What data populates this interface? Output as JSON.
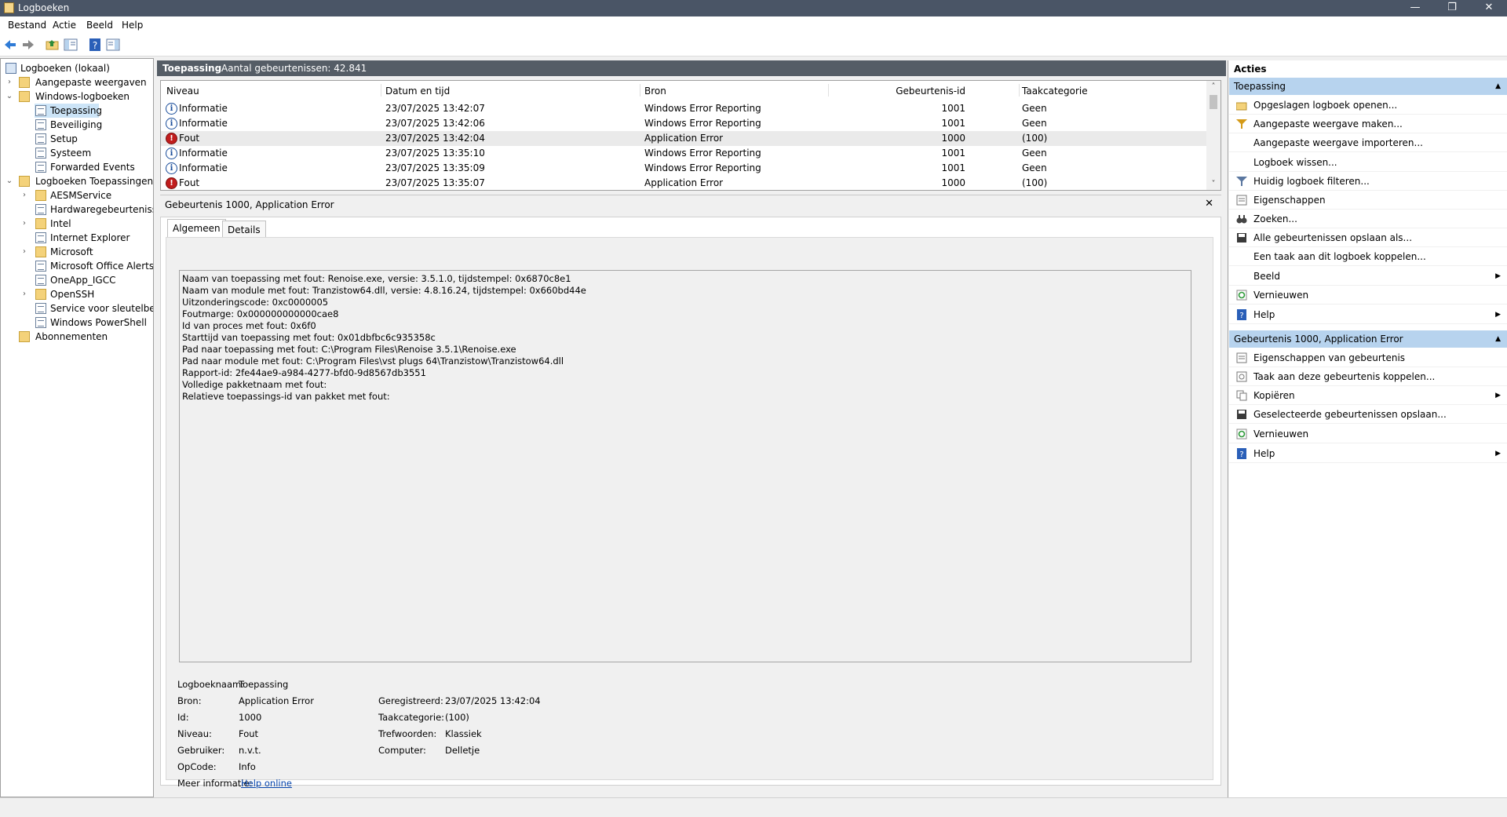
{
  "window": {
    "title": "Logboeken",
    "minimize": "—",
    "maximize": "❐",
    "close": "✕"
  },
  "menu": [
    {
      "label": "Bestand"
    },
    {
      "label": "Actie"
    },
    {
      "label": "Beeld"
    },
    {
      "label": "Help"
    }
  ],
  "tree": {
    "root": "Logboeken (lokaal)",
    "custom_views": "Aangepaste weergaven",
    "windows_logs": "Windows-logboeken",
    "windows_children": [
      "Toepassing",
      "Beveiliging",
      "Setup",
      "Systeem",
      "Forwarded Events"
    ],
    "app_logs": "Logboeken Toepassingen en",
    "app_children": [
      "AESMService",
      "Hardwaregebeurtenissen",
      "Intel",
      "Internet Explorer",
      "Microsoft",
      "Microsoft Office Alerts",
      "OneApp_IGCC",
      "OpenSSH",
      "Service voor sleutelbehee",
      "Windows PowerShell"
    ],
    "subscriptions": "Abonnementen"
  },
  "center": {
    "log_name": "Toepassing",
    "count_text": "Aantal gebeurtenissen: 42.841"
  },
  "columns": [
    "Niveau",
    "Datum en tijd",
    "Bron",
    "Gebeurtenis-id",
    "Taakcategorie"
  ],
  "events": [
    {
      "level": "Informatie",
      "type": "info",
      "datetime": "23/07/2025 13:42:07",
      "source": "Windows Error Reporting",
      "id": "1001",
      "category": "Geen"
    },
    {
      "level": "Informatie",
      "type": "info",
      "datetime": "23/07/2025 13:42:06",
      "source": "Windows Error Reporting",
      "id": "1001",
      "category": "Geen"
    },
    {
      "level": "Fout",
      "type": "error",
      "datetime": "23/07/2025 13:42:04",
      "source": "Application Error",
      "id": "1000",
      "category": "(100)"
    },
    {
      "level": "Informatie",
      "type": "info",
      "datetime": "23/07/2025 13:35:10",
      "source": "Windows Error Reporting",
      "id": "1001",
      "category": "Geen"
    },
    {
      "level": "Informatie",
      "type": "info",
      "datetime": "23/07/2025 13:35:09",
      "source": "Windows Error Reporting",
      "id": "1001",
      "category": "Geen"
    },
    {
      "level": "Fout",
      "type": "error",
      "datetime": "23/07/2025 13:35:07",
      "source": "Application Error",
      "id": "1000",
      "category": "(100)"
    }
  ],
  "detail": {
    "header": "Gebeurtenis 1000, Application Error",
    "tabs": [
      "Algemeen",
      "Details"
    ],
    "description": [
      "Naam van toepassing met fout: Renoise.exe, versie: 3.5.1.0, tijdstempel: 0x6870c8e1",
      "Naam van module met fout: Tranzistow64.dll, versie: 4.8.16.24, tijdstempel: 0x660bd44e",
      "Uitzonderingscode: 0xc0000005",
      "Foutmarge: 0x000000000000cae8",
      "Id van proces met fout: 0x6f0",
      "Starttijd van toepassing met fout: 0x01dbfbc6c935358c",
      "Pad naar toepassing met fout: C:\\Program Files\\Renoise 3.5.1\\Renoise.exe",
      "Pad naar module met fout: C:\\Program Files\\vst plugs 64\\Tranzistow\\Tranzistow64.dll",
      "Rapport-id: 2fe44ae9-a984-4277-bfd0-9d8567db3551",
      "Volledige pakketnaam met fout:",
      "Relatieve toepassings-id van pakket met fout:"
    ],
    "fields_left": [
      {
        "label": "Logboeknaam:",
        "value": "Toepassing"
      },
      {
        "label": "Bron:",
        "value": "Application Error"
      },
      {
        "label": "Id:",
        "value": "1000"
      },
      {
        "label": "Niveau:",
        "value": "Fout"
      },
      {
        "label": "Gebruiker:",
        "value": "n.v.t."
      },
      {
        "label": "OpCode:",
        "value": "Info"
      },
      {
        "label": "Meer informatie:",
        "value": "Help online"
      }
    ],
    "fields_right": [
      {
        "label": "Geregistreerd:",
        "value": "23/07/2025 13:42:04"
      },
      {
        "label": "Taakcategorie:",
        "value": "(100)"
      },
      {
        "label": "Trefwoorden:",
        "value": "Klassiek"
      },
      {
        "label": "Computer:",
        "value": "Delletje"
      }
    ]
  },
  "actions": {
    "title": "Acties",
    "section1": "Toepassing",
    "items1": [
      {
        "label": "Opgeslagen logboek openen...",
        "icon": "folder-open-icon"
      },
      {
        "label": "Aangepaste weergave maken...",
        "icon": "filter-icon"
      },
      {
        "label": "Aangepaste weergave importeren...",
        "icon": ""
      },
      {
        "label": "Logboek wissen...",
        "icon": ""
      },
      {
        "label": "Huidig logboek filteren...",
        "icon": "filter-icon"
      },
      {
        "label": "Eigenschappen",
        "icon": "properties-icon"
      },
      {
        "label": "Zoeken...",
        "icon": "binoculars-icon"
      },
      {
        "label": "Alle gebeurtenissen opslaan als...",
        "icon": "save-icon"
      },
      {
        "label": "Een taak aan dit logboek koppelen...",
        "icon": ""
      },
      {
        "label": "Beeld",
        "icon": "",
        "submenu": true
      },
      {
        "label": "Vernieuwen",
        "icon": "refresh-icon"
      },
      {
        "label": "Help",
        "icon": "help-icon",
        "submenu": true
      }
    ],
    "section2": "Gebeurtenis 1000, Application Error",
    "items2": [
      {
        "label": "Eigenschappen van gebeurtenis",
        "icon": "properties-icon"
      },
      {
        "label": "Taak aan deze gebeurtenis koppelen...",
        "icon": "task-icon"
      },
      {
        "label": "Kopiëren",
        "icon": "copy-icon",
        "submenu": true
      },
      {
        "label": "Geselecteerde gebeurtenissen opslaan...",
        "icon": "save-icon"
      },
      {
        "label": "Vernieuwen",
        "icon": "refresh-icon"
      },
      {
        "label": "Help",
        "icon": "help-icon",
        "submenu": true
      }
    ]
  }
}
